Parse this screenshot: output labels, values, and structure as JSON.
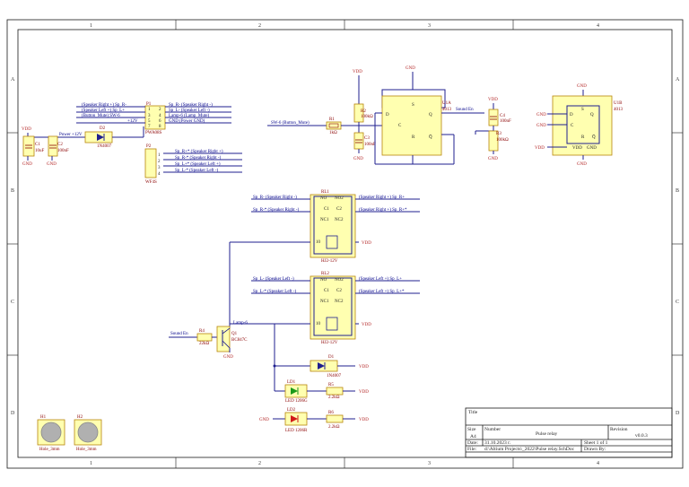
{
  "sheet": {
    "zones_top": [
      "1",
      "2",
      "3",
      "4"
    ],
    "zones_side": [
      "A",
      "B",
      "C",
      "D"
    ]
  },
  "title_block": {
    "title_label": "Title",
    "size_label": "Size",
    "size": "A4",
    "number_label": "Number",
    "number": "Pulse relay",
    "revision_label": "Revision",
    "revision": "v0.0.3",
    "date_label": "Date:",
    "date": "31.10.2023 г.",
    "sheet_label": "Sheet 1 of 1",
    "file_label": "File:",
    "file": "d:\\Altium Projects\\_2022\\Pulse relay.SchDoc",
    "drawn_label": "Drawn By:"
  },
  "power": {
    "vdd": "VDD",
    "gnd": "GND",
    "power12": "Power +12V"
  },
  "components": {
    "c1": {
      "ref": "C1",
      "value": "10uF"
    },
    "c2": {
      "ref": "C2",
      "value": "100nF"
    },
    "d2": {
      "ref": "D2",
      "value": "1N4007"
    },
    "p1": {
      "ref": "P1",
      "value": "PWA08S",
      "pins": [
        "1",
        "2",
        "3",
        "4",
        "5",
        "6",
        "7",
        "8"
      ],
      "left_nets": [
        "(Speaker Right +)   Sp_R-",
        "(Speaker Left +)   Sp_L+",
        "(Button_Mute)   SW-6",
        "+12V"
      ],
      "right_nets": [
        "Sp_R-   (Speaker Right -)",
        "Sp_L-   (Speaker Left -)",
        "Lamp-6 (Lamp_Mute)",
        "GND   (Power GND)"
      ]
    },
    "p2": {
      "ref": "P2",
      "value": "WF4S",
      "pins": [
        "1",
        "2",
        "3",
        "4"
      ],
      "nets": [
        "Sp_R+*   (Speaker Right +)",
        "Sp_R-*   (Speaker Right -)",
        "Sp_L+*   (Speaker Left +)",
        "Sp_L-*   (Speaker Left -)"
      ]
    },
    "r1": {
      "ref": "R1",
      "value": "1kΩ"
    },
    "r2": {
      "ref": "R2",
      "value": "100kΩ"
    },
    "c3": {
      "ref": "C3",
      "value": "100nF"
    },
    "u1a": {
      "ref": "U1A",
      "value": "4013",
      "pins": [
        "D",
        "Q",
        "C",
        "Q̅",
        "R",
        "S"
      ]
    },
    "c4": {
      "ref": "C4",
      "value": "100nF"
    },
    "r3": {
      "ref": "R3",
      "value": "100kΩ"
    },
    "u1b": {
      "ref": "U1B",
      "value": "4013"
    },
    "rl1": {
      "ref": "RL1",
      "value": "HJ2-12V",
      "pins": [
        "NO",
        "C1",
        "NC1",
        "NO2",
        "C2",
        "NC2"
      ]
    },
    "rl2": {
      "ref": "RL2",
      "value": "HJ2-12V"
    },
    "r4": {
      "ref": "R4",
      "value": "22kΩ"
    },
    "q1": {
      "ref": "Q1",
      "value": "BC847C"
    },
    "d1": {
      "ref": "D1",
      "value": "1N4007"
    },
    "ld1": {
      "ref": "LD1",
      "value": "LED 1206G"
    },
    "r5": {
      "ref": "R5",
      "value": "2.2kΩ"
    },
    "ld2": {
      "ref": "LD2",
      "value": "LED 1206R"
    },
    "r6": {
      "ref": "R6",
      "value": "2.2kΩ"
    },
    "h1": {
      "ref": "H1",
      "value": "Hole_3mm"
    },
    "h2": {
      "ref": "H2",
      "value": "Hole_3mm"
    }
  },
  "nets": {
    "sw6_button": "SW-6   (Button_Mute)",
    "sound_en": "Sound En",
    "lamp6": "Lamp-6",
    "rl1_left": [
      "Sp_R-   (Speaker Right -)",
      "Sp_R-*  (Speaker Right -)"
    ],
    "rl1_right": [
      "(Speaker Right +)   Sp_R+",
      "(Speaker Right +)   Sp_R+*"
    ],
    "rl2_left": [
      "Sp_L-   (Speaker Left -)",
      "Sp_L-*  (Speaker Left -)"
    ],
    "rl2_right": [
      "(Speaker Left +)   Sp_L+",
      "(Speaker Left +)   Sp_L+*"
    ]
  },
  "colors": {
    "wire": "#1f1f8f",
    "body": "#ffffb0",
    "border": "#b8860b",
    "label": "#8b0000",
    "led_green": "#1a9a1a",
    "led_red": "#d11a1a"
  }
}
